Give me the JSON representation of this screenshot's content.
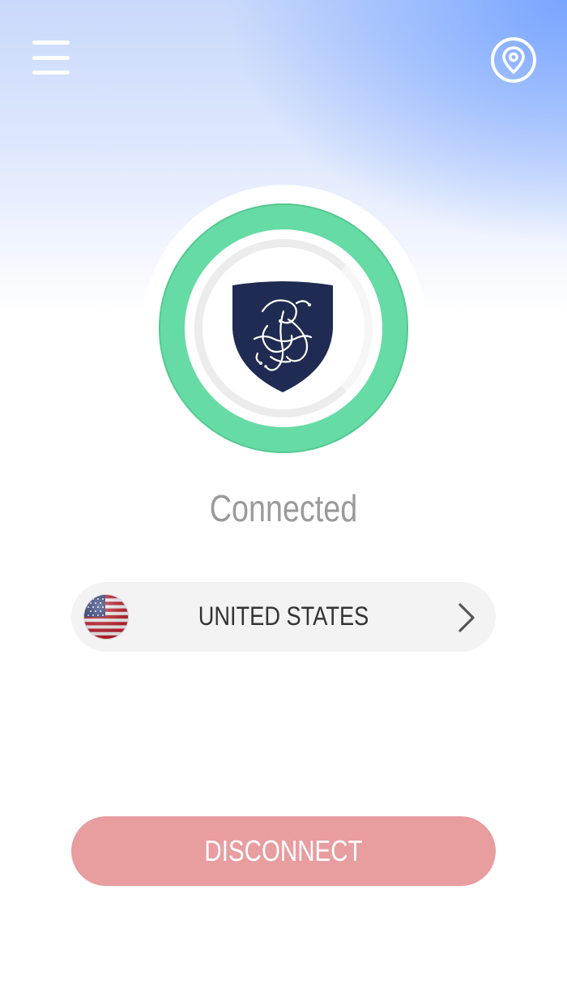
{
  "header": {
    "menu_icon": "hamburger-menu-icon",
    "location_icon": "map-pin-icon"
  },
  "connection": {
    "status": "Connected",
    "ring_color": "#67dba5",
    "logo_icon": "shield-logo-icon"
  },
  "country_selector": {
    "flag_icon": "us-flag-icon",
    "country": "UNITED STATES",
    "chevron_icon": "chevron-right-icon"
  },
  "actions": {
    "disconnect_label": "DISCONNECT",
    "disconnect_color": "#e89d9f"
  }
}
